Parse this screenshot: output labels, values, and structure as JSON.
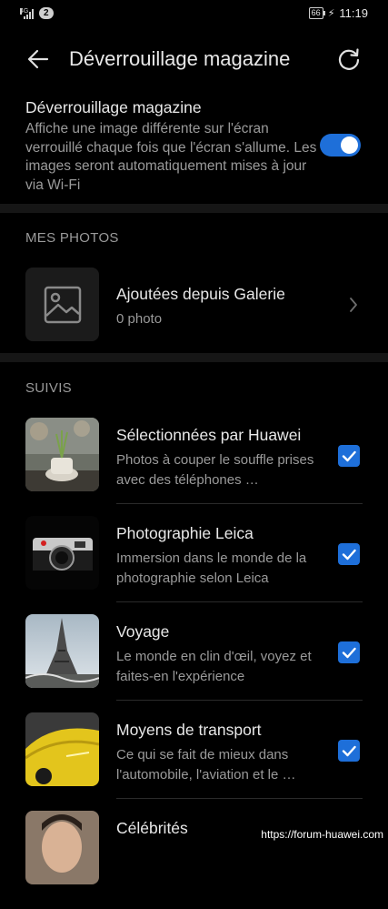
{
  "status_bar": {
    "network": "4G",
    "notifications_badge": "2",
    "battery": "66",
    "time": "11:19"
  },
  "header": {
    "title": "Déverrouillage magazine",
    "back_icon": "arrow-left-icon",
    "refresh_icon": "refresh-icon"
  },
  "intro": {
    "heading": "Déverrouillage magazine",
    "description": "Affiche une image différente sur l'écran verrouillé chaque fois que l'écran s'allume. Les images seront automatiquement mises à jour via Wi-Fi",
    "toggle_on": true
  },
  "my_photos": {
    "section_title": "MES PHOTOS",
    "gallery_title": "Ajoutées depuis Galerie",
    "gallery_count": "0 photo"
  },
  "subscriptions": {
    "section_title": "SUIVIS",
    "items": [
      {
        "title": "Sélectionnées par Huawei",
        "desc": "Photos à couper le souffle prises avec des téléphones …",
        "checked": true
      },
      {
        "title": "Photographie Leica",
        "desc": "Immersion dans le monde de la photographie selon Leica",
        "checked": true
      },
      {
        "title": "Voyage",
        "desc": "Le monde en clin d'œil, voyez et faites-en l'expérience",
        "checked": true
      },
      {
        "title": "Moyens de transport",
        "desc": "Ce qui se fait de mieux dans l'automobile, l'aviation et le …",
        "checked": true
      },
      {
        "title": "Célébrités",
        "desc": "",
        "checked": true
      }
    ]
  },
  "watermark": "https://forum-huawei.com",
  "colors": {
    "accent": "#1e6fd9",
    "background": "#000000"
  }
}
